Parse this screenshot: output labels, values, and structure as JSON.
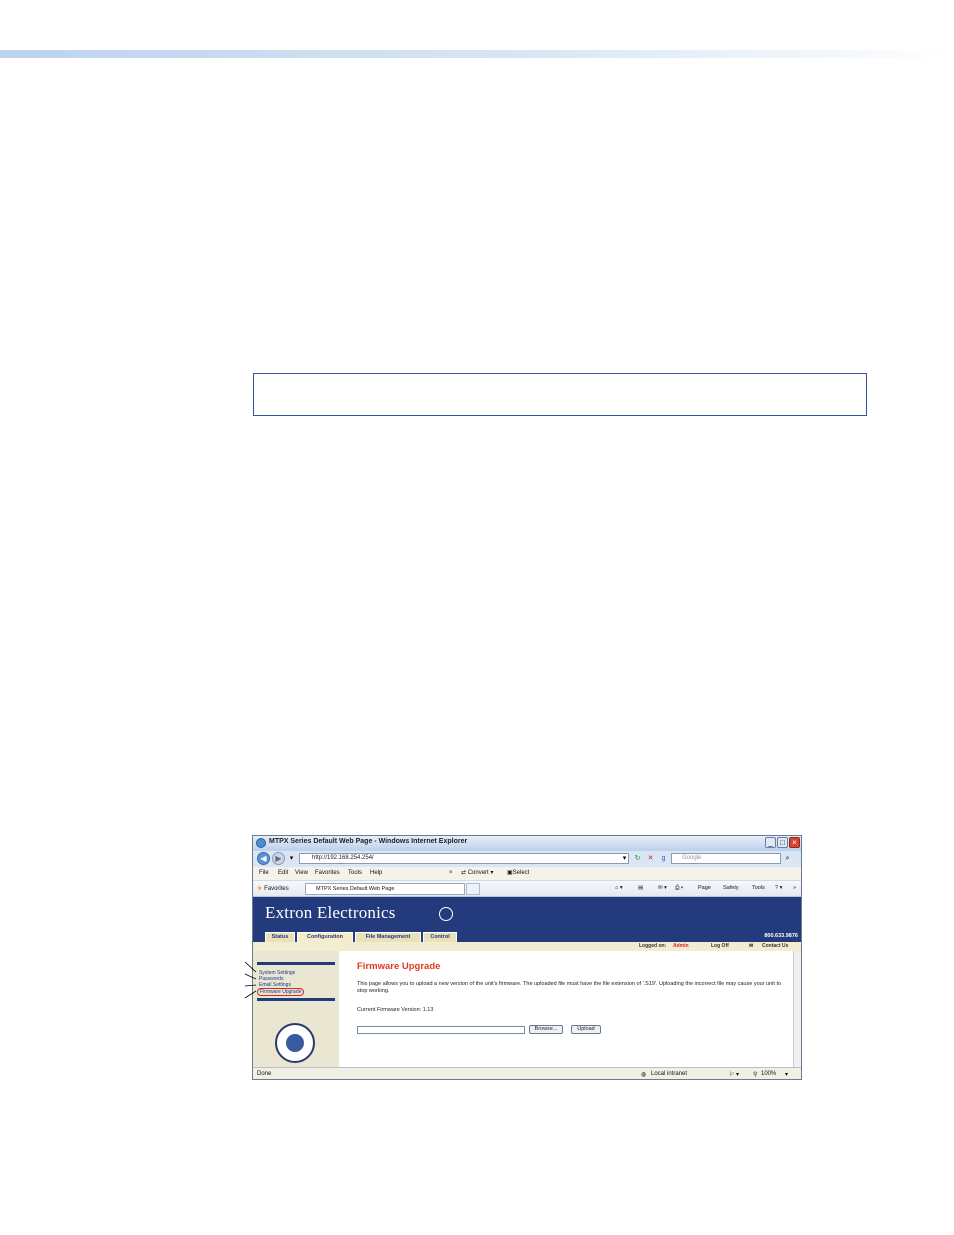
{
  "browser": {
    "window_title": "MTPX Series Default Web Page - Windows Internet Explorer",
    "address": "http://192.168.254.254/",
    "search_placeholder": "Google",
    "menu": [
      "File",
      "Edit",
      "View",
      "Favorites",
      "Tools",
      "Help"
    ],
    "toolbar_convert": "Convert",
    "toolbar_select": "Select",
    "favorites_label": "Favorites",
    "tab_label": "MTPX Series Default Web Page",
    "commands": [
      "Page",
      "Safety",
      "Tools"
    ],
    "status_left": "Done",
    "status_zone": "Local intranet",
    "zoom": "100%"
  },
  "extron": {
    "logo_text": "Extron Electronics",
    "tabs": [
      "Status",
      "Configuration",
      "File Management",
      "Control"
    ],
    "phone": "800.633.9876",
    "logged_on_label": "Logged on:",
    "logged_on_user": "Admin",
    "log_off": "Log Off",
    "contact_us": "Contact Us",
    "nav_items": [
      "System Settings",
      "Passwords",
      "Email Settings",
      "Firmware Upgrade"
    ],
    "page_title": "Firmware Upgrade",
    "description": "This page allows you to upload a new version of the unit's firmware. The uploaded file must have the file extension of '.S19'. Uploading the incorrect file may cause your unit to stop working.",
    "current_firmware": "Current Firmware Version: 1.13",
    "browse_label": "Browse...",
    "upload_label": "Upload"
  }
}
